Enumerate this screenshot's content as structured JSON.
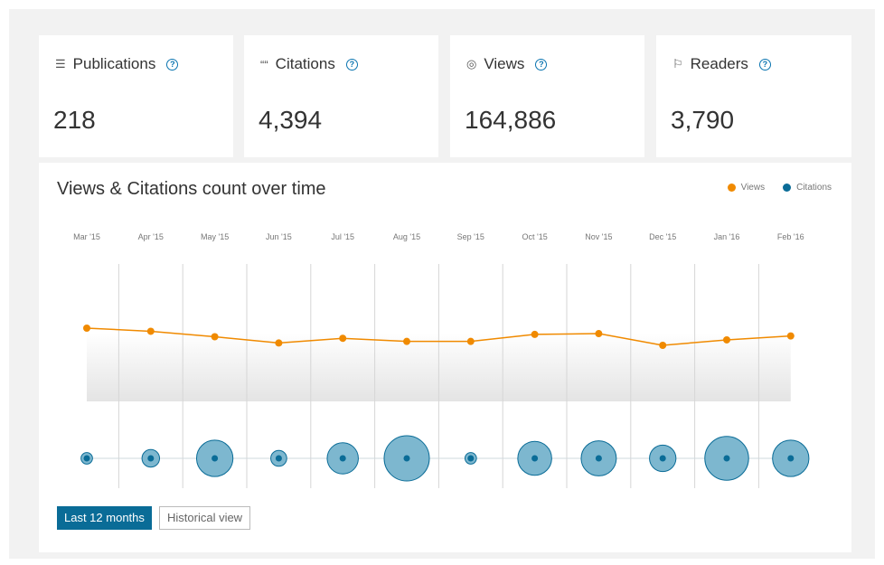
{
  "metrics": [
    {
      "label": "Publications",
      "icon": "document-icon",
      "glyph": "☰",
      "value": "218"
    },
    {
      "label": "Citations",
      "icon": "quote-icon",
      "glyph": "““",
      "value": "4,394"
    },
    {
      "label": "Views",
      "icon": "eye-icon",
      "glyph": "◎",
      "value": "164,886"
    },
    {
      "label": "Readers",
      "icon": "reader-icon",
      "glyph": "⚐",
      "value": "3,790"
    }
  ],
  "help_glyph": "?",
  "chart": {
    "title": "Views & Citations count over time",
    "legend": [
      {
        "label": "Views",
        "color": "#f08a00"
      },
      {
        "label": "Citations",
        "color": "#0a6c97"
      }
    ]
  },
  "chart_data": {
    "type": "line",
    "categories": [
      "Mar '15",
      "Apr '15",
      "May '15",
      "Jun '15",
      "Jul '15",
      "Aug '15",
      "Sep '15",
      "Oct '15",
      "Nov '15",
      "Dec '15",
      "Jan '16",
      "Feb '16"
    ],
    "series": [
      {
        "name": "Views",
        "values": [
          100,
          96,
          89,
          81,
          87,
          83,
          83,
          92,
          93,
          78,
          85,
          90
        ],
        "color": "#f08a00"
      },
      {
        "name": "Citations",
        "values": [
          1,
          4,
          26,
          3,
          18,
          43,
          1,
          22,
          24,
          12,
          40,
          26
        ],
        "color": "#0a6c97"
      }
    ],
    "grid": true,
    "legend_position": "top-right"
  },
  "buttons": {
    "last12": "Last 12 months",
    "historical": "Historical view"
  }
}
